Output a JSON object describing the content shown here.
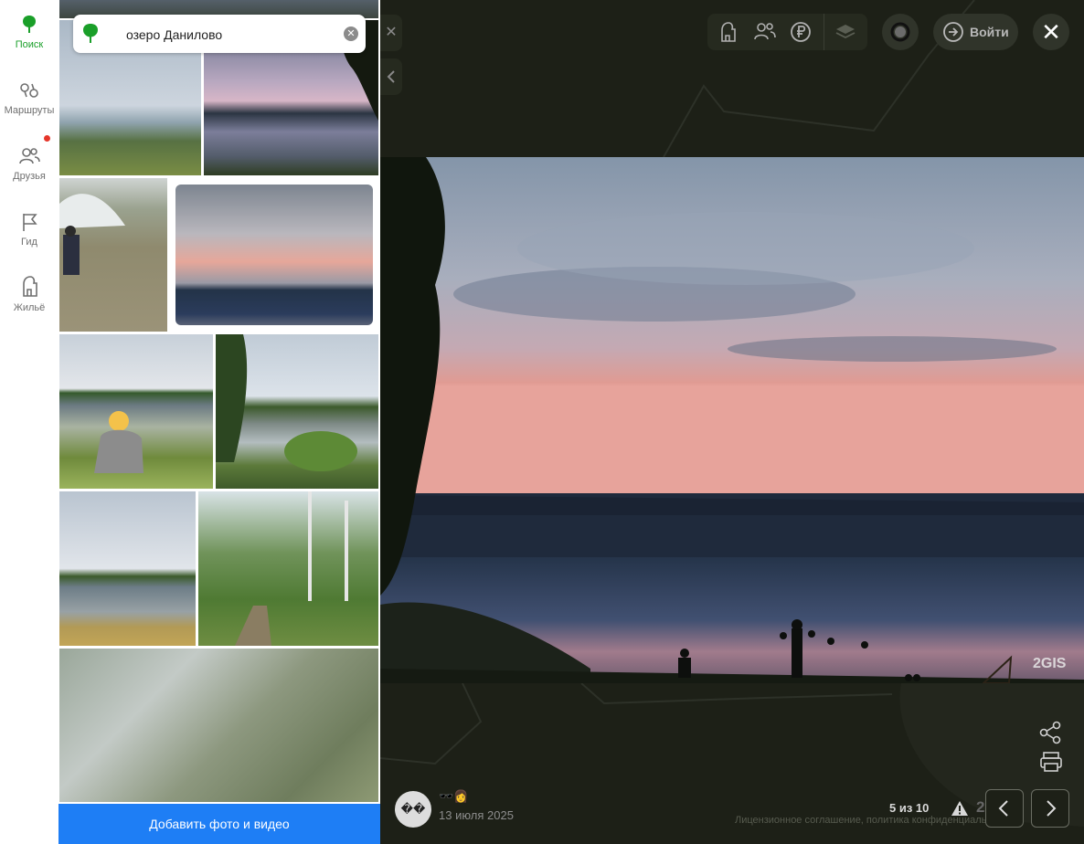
{
  "nav": {
    "items": [
      {
        "label": "Поиск",
        "icon": "pin-icon",
        "active": true
      },
      {
        "label": "Маршруты",
        "icon": "route-icon",
        "active": false
      },
      {
        "label": "Друзья",
        "icon": "friends-icon",
        "active": false,
        "badge": true
      },
      {
        "label": "Гид",
        "icon": "flag-icon",
        "active": false
      },
      {
        "label": "Жильё",
        "icon": "house-icon",
        "active": false
      }
    ]
  },
  "search": {
    "value": "озеро Данилово"
  },
  "gallery": {
    "add_button": "Добавить фото и видео"
  },
  "header": {
    "login_label": "Войти"
  },
  "viewer": {
    "watermark": "2GIS",
    "author_emoji": "🕶️👩",
    "date": "13 июля 2025",
    "counter": "5 из 10",
    "brand": "2ГИС",
    "legal": "Лицензионное соглашение, политика конфиденциальности"
  },
  "colors": {
    "accent_green": "#1a9f29",
    "button_blue": "#1e7ef5",
    "badge_red": "#e5352a"
  }
}
